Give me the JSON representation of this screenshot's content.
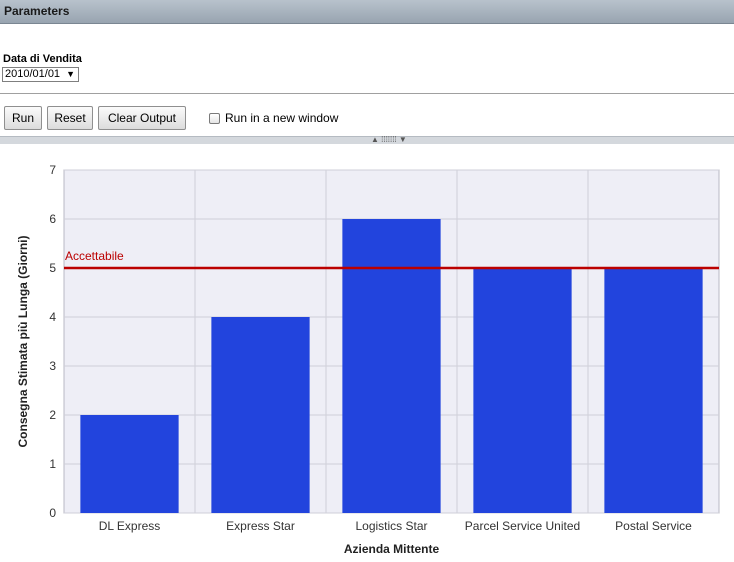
{
  "panel": {
    "title": "Parameters"
  },
  "parameters": {
    "date_label": "Data di Vendita",
    "date_value": "2010/01/01"
  },
  "toolbar": {
    "run_label": "Run",
    "reset_label": "Reset",
    "clear_label": "Clear Output",
    "new_window_label": "Run in a new window",
    "new_window_checked": false
  },
  "chart_data": {
    "type": "bar",
    "categories": [
      "DL Express",
      "Express Star",
      "Logistics Star",
      "Parcel Service United",
      "Postal Service"
    ],
    "values": [
      2,
      4,
      6,
      5,
      5
    ],
    "xlabel": "Azienda Mittente",
    "ylabel": "Consegna Stimata più Lunga (Giorni)",
    "ylim": [
      0,
      7
    ],
    "yticks": [
      0,
      1,
      2,
      3,
      4,
      5,
      6,
      7
    ],
    "grid": true,
    "bar_color": "#2244dd",
    "plot_background": "#eeeef6",
    "reference_line": {
      "value": 5,
      "label": "Accettabile",
      "color": "#bb0000"
    }
  }
}
